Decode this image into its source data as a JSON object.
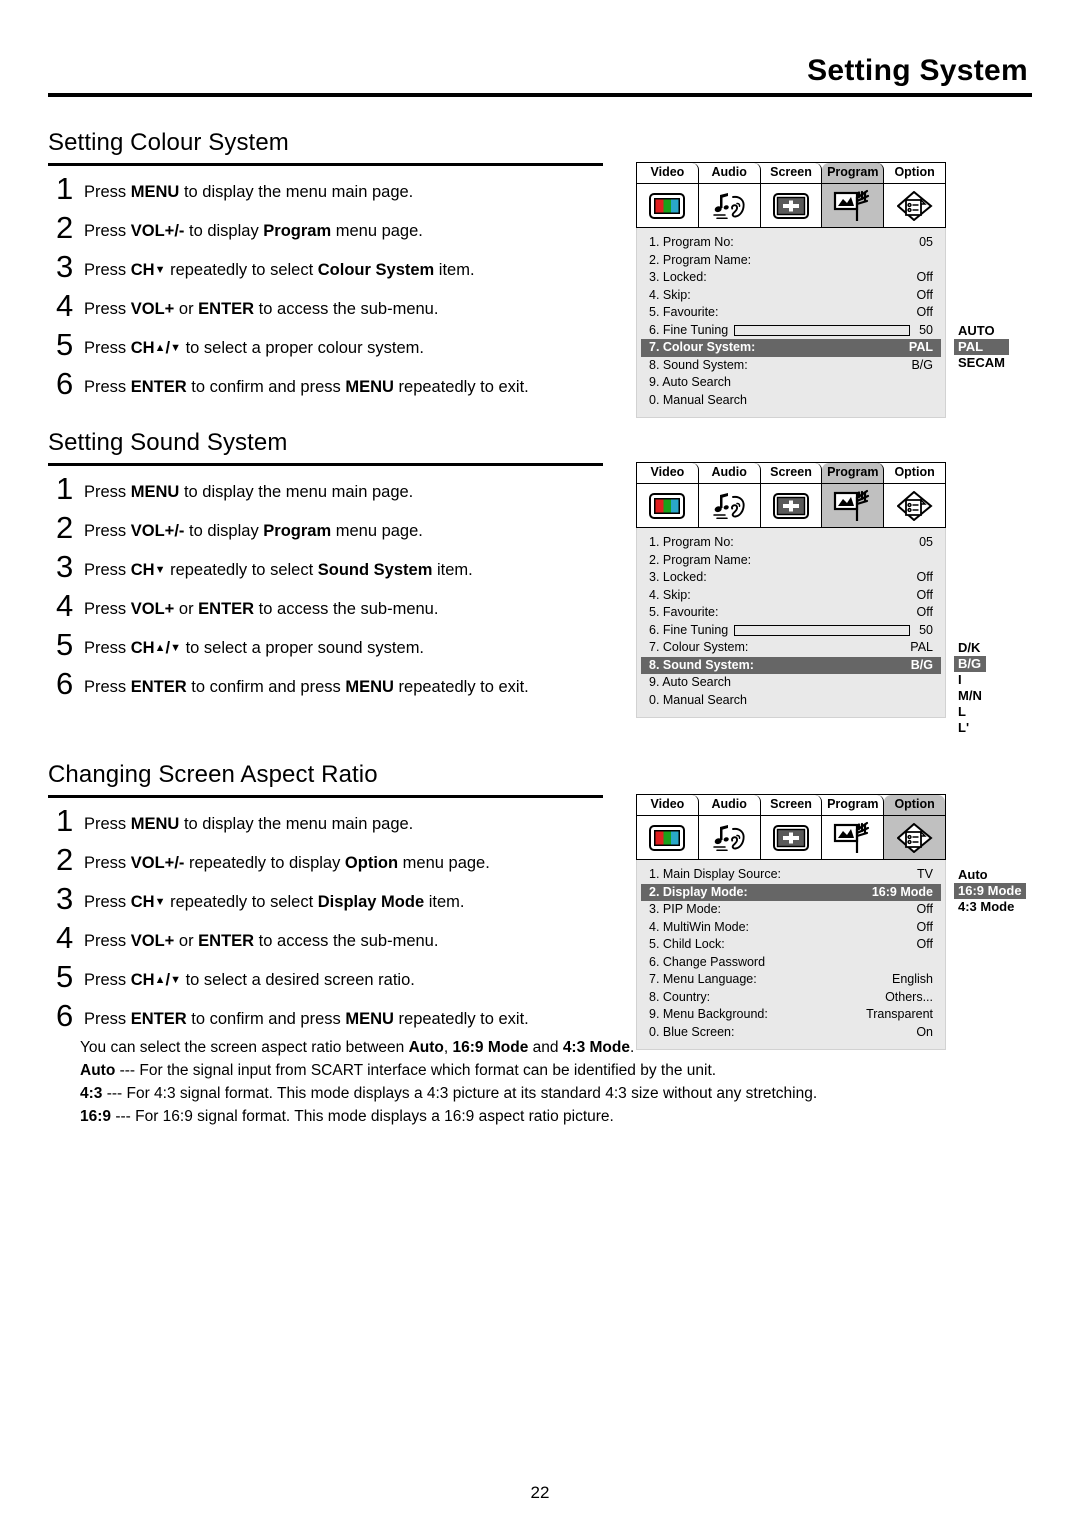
{
  "header": {
    "title": "Setting System"
  },
  "page_number": "22",
  "sections": [
    {
      "title": "Setting Colour System",
      "steps": [
        {
          "num": "1",
          "parts": [
            {
              "t": "Press ",
              "b": false
            },
            {
              "t": "MENU",
              "b": true
            },
            {
              "t": " to display the menu main page.",
              "b": false
            }
          ]
        },
        {
          "num": "2",
          "parts": [
            {
              "t": "Press ",
              "b": false
            },
            {
              "t": "VOL+/-",
              "b": true
            },
            {
              "t": " to display ",
              "b": false
            },
            {
              "t": "Program",
              "b": true
            },
            {
              "t": " menu page.",
              "b": false
            }
          ]
        },
        {
          "num": "3",
          "parts": [
            {
              "t": "Press ",
              "b": false
            },
            {
              "t": "CH",
              "b": true
            },
            {
              "t": "▼",
              "b": true,
              "arrow": true
            },
            {
              "t": " repeatedly to select ",
              "b": false
            },
            {
              "t": "Colour System",
              "b": true
            },
            {
              "t": " item.",
              "b": false
            }
          ]
        },
        {
          "num": "4",
          "parts": [
            {
              "t": "Press ",
              "b": false
            },
            {
              "t": "VOL+",
              "b": true
            },
            {
              "t": " or ",
              "b": false
            },
            {
              "t": "ENTER",
              "b": true
            },
            {
              "t": " to access the sub-menu.",
              "b": false
            }
          ]
        },
        {
          "num": "5",
          "parts": [
            {
              "t": "Press ",
              "b": false
            },
            {
              "t": "CH",
              "b": true
            },
            {
              "t": "▲",
              "b": true,
              "arrow": true
            },
            {
              "t": "/",
              "b": true
            },
            {
              "t": "▼",
              "b": true,
              "arrow": true
            },
            {
              "t": " to select a proper colour system.",
              "b": false
            }
          ]
        },
        {
          "num": "6",
          "parts": [
            {
              "t": "Press ",
              "b": false
            },
            {
              "t": "ENTER",
              "b": true
            },
            {
              "t": " to confirm and press ",
              "b": false
            },
            {
              "t": "MENU",
              "b": true
            },
            {
              "t": " repeatedly to exit.",
              "b": false
            }
          ]
        }
      ]
    },
    {
      "title": "Setting Sound System",
      "steps": [
        {
          "num": "1",
          "parts": [
            {
              "t": "Press ",
              "b": false
            },
            {
              "t": "MENU",
              "b": true
            },
            {
              "t": " to display the menu main page.",
              "b": false
            }
          ]
        },
        {
          "num": "2",
          "parts": [
            {
              "t": "Press ",
              "b": false
            },
            {
              "t": "VOL+/-",
              "b": true
            },
            {
              "t": " to display ",
              "b": false
            },
            {
              "t": "Program",
              "b": true
            },
            {
              "t": " menu page.",
              "b": false
            }
          ]
        },
        {
          "num": "3",
          "parts": [
            {
              "t": "Press ",
              "b": false
            },
            {
              "t": "CH",
              "b": true
            },
            {
              "t": "▼",
              "b": true,
              "arrow": true
            },
            {
              "t": " repeatedly to select ",
              "b": false
            },
            {
              "t": "Sound System",
              "b": true
            },
            {
              "t": " item.",
              "b": false
            }
          ]
        },
        {
          "num": "4",
          "parts": [
            {
              "t": "Press ",
              "b": false
            },
            {
              "t": "VOL+",
              "b": true
            },
            {
              "t": " or ",
              "b": false
            },
            {
              "t": "ENTER",
              "b": true
            },
            {
              "t": " to access the sub-menu.",
              "b": false
            }
          ]
        },
        {
          "num": "5",
          "parts": [
            {
              "t": "Press ",
              "b": false
            },
            {
              "t": "CH",
              "b": true
            },
            {
              "t": "▲",
              "b": true,
              "arrow": true
            },
            {
              "t": "/",
              "b": true
            },
            {
              "t": "▼",
              "b": true,
              "arrow": true
            },
            {
              "t": " to select a proper sound system.",
              "b": false
            }
          ]
        },
        {
          "num": "6",
          "parts": [
            {
              "t": "Press ",
              "b": false
            },
            {
              "t": "ENTER",
              "b": true
            },
            {
              "t": " to confirm and press ",
              "b": false
            },
            {
              "t": "MENU",
              "b": true
            },
            {
              "t": " repeatedly to exit.",
              "b": false
            }
          ]
        }
      ]
    },
    {
      "title": "Changing Screen Aspect Ratio",
      "steps": [
        {
          "num": "1",
          "parts": [
            {
              "t": "Press ",
              "b": false
            },
            {
              "t": "MENU",
              "b": true
            },
            {
              "t": " to display the menu main page.",
              "b": false
            }
          ]
        },
        {
          "num": "2",
          "parts": [
            {
              "t": "Press ",
              "b": false
            },
            {
              "t": "VOL+/-",
              "b": true
            },
            {
              "t": " repeatedly to display ",
              "b": false
            },
            {
              "t": "Option",
              "b": true
            },
            {
              "t": " menu page.",
              "b": false
            }
          ]
        },
        {
          "num": "3",
          "parts": [
            {
              "t": "Press ",
              "b": false
            },
            {
              "t": "CH",
              "b": true
            },
            {
              "t": "▼",
              "b": true,
              "arrow": true
            },
            {
              "t": " repeatedly to select ",
              "b": false
            },
            {
              "t": "Display Mode",
              "b": true
            },
            {
              "t": " item.",
              "b": false
            }
          ]
        },
        {
          "num": "4",
          "parts": [
            {
              "t": "Press ",
              "b": false
            },
            {
              "t": "VOL+",
              "b": true
            },
            {
              "t": " or ",
              "b": false
            },
            {
              "t": "ENTER",
              "b": true
            },
            {
              "t": " to access the sub-menu.",
              "b": false
            }
          ]
        },
        {
          "num": "5",
          "parts": [
            {
              "t": "Press ",
              "b": false
            },
            {
              "t": "CH",
              "b": true
            },
            {
              "t": "▲",
              "b": true,
              "arrow": true
            },
            {
              "t": "/",
              "b": true
            },
            {
              "t": "▼",
              "b": true,
              "arrow": true
            },
            {
              "t": " to select a desired screen ratio.",
              "b": false
            }
          ]
        },
        {
          "num": "6",
          "parts": [
            {
              "t": "Press ",
              "b": false
            },
            {
              "t": "ENTER",
              "b": true
            },
            {
              "t": " to confirm and press ",
              "b": false
            },
            {
              "t": "MENU",
              "b": true
            },
            {
              "t": " repeatedly to exit.",
              "b": false
            }
          ]
        }
      ]
    }
  ],
  "osd_tabs": [
    "Video",
    "Audio",
    "Screen",
    "Program",
    "Option"
  ],
  "osd_icon_names": [
    "video-colorbars-icon",
    "audio-note-ear-icon",
    "screen-crosshair-icon",
    "program-antenna-icon",
    "option-checklist-icon"
  ],
  "osd_panels": [
    {
      "active_tab": "Program",
      "active_index": 3,
      "rows": [
        {
          "label": "1. Program No:",
          "value": "05",
          "selected": false,
          "slider": false
        },
        {
          "label": "2. Program Name:",
          "value": "",
          "selected": false,
          "slider": false
        },
        {
          "label": "3. Locked:",
          "value": "Off",
          "selected": false,
          "slider": false
        },
        {
          "label": "4. Skip:",
          "value": "Off",
          "selected": false,
          "slider": false
        },
        {
          "label": "5. Favourite:",
          "value": "Off",
          "selected": false,
          "slider": false
        },
        {
          "label": "6. Fine Tuning",
          "value": "50",
          "selected": false,
          "slider": true,
          "slider_fill": 0
        },
        {
          "label": "7. Colour System:",
          "value": "PAL",
          "selected": true,
          "slider": false
        },
        {
          "label": "8. Sound System:",
          "value": "B/G",
          "selected": false,
          "slider": false
        },
        {
          "label": "9. Auto Search",
          "value": "",
          "selected": false,
          "slider": false
        },
        {
          "label": "0. Manual Search",
          "value": "",
          "selected": false,
          "slider": false
        }
      ],
      "submenu": {
        "options": [
          "AUTO",
          "PAL",
          "SECAM"
        ],
        "selected": "PAL"
      }
    },
    {
      "active_tab": "Program",
      "active_index": 3,
      "rows": [
        {
          "label": "1. Program No:",
          "value": "05",
          "selected": false,
          "slider": false
        },
        {
          "label": "2. Program Name:",
          "value": "",
          "selected": false,
          "slider": false
        },
        {
          "label": "3. Locked:",
          "value": "Off",
          "selected": false,
          "slider": false
        },
        {
          "label": "4. Skip:",
          "value": "Off",
          "selected": false,
          "slider": false
        },
        {
          "label": "5. Favourite:",
          "value": "Off",
          "selected": false,
          "slider": false
        },
        {
          "label": "6. Fine Tuning",
          "value": "50",
          "selected": false,
          "slider": true,
          "slider_fill": 0
        },
        {
          "label": "7. Colour System:",
          "value": "PAL",
          "selected": false,
          "slider": false
        },
        {
          "label": "8. Sound System:",
          "value": "B/G",
          "selected": true,
          "slider": false
        },
        {
          "label": "9. Auto Search",
          "value": "",
          "selected": false,
          "slider": false
        },
        {
          "label": "0. Manual Search",
          "value": "",
          "selected": false,
          "slider": false
        }
      ],
      "submenu": {
        "options": [
          "D/K",
          "B/G",
          "I",
          "M/N",
          "L",
          "L'"
        ],
        "selected": "B/G"
      }
    },
    {
      "active_tab": "Option",
      "active_index": 4,
      "rows": [
        {
          "label": "1. Main Display Source:",
          "value": "TV",
          "selected": false,
          "slider": false
        },
        {
          "label": "2. Display Mode:",
          "value": "16:9 Mode",
          "selected": true,
          "slider": false
        },
        {
          "label": "3. PIP Mode:",
          "value": "Off",
          "selected": false,
          "slider": false
        },
        {
          "label": "4. MultiWin Mode:",
          "value": "Off",
          "selected": false,
          "slider": false
        },
        {
          "label": "5. Child Lock:",
          "value": "Off",
          "selected": false,
          "slider": false
        },
        {
          "label": "6. Change Password",
          "value": "",
          "selected": false,
          "slider": false
        },
        {
          "label": "7. Menu Language:",
          "value": "English",
          "selected": false,
          "slider": false
        },
        {
          "label": "8. Country:",
          "value": "Others...",
          "selected": false,
          "slider": false
        },
        {
          "label": "9. Menu Background:",
          "value": "Transparent",
          "selected": false,
          "slider": false
        },
        {
          "label": "0. Blue Screen:",
          "value": "On",
          "selected": false,
          "slider": false
        }
      ],
      "submenu": {
        "options": [
          "Auto",
          "16:9 Mode",
          "4:3 Mode"
        ],
        "selected": "16:9 Mode"
      }
    }
  ],
  "notes": [
    [
      {
        "t": "You can select the screen aspect ratio between ",
        "b": false
      },
      {
        "t": "Auto",
        "b": true
      },
      {
        "t": ", ",
        "b": false
      },
      {
        "t": "16:9 Mode",
        "b": true
      },
      {
        "t": " and ",
        "b": false
      },
      {
        "t": "4:3 Mode",
        "b": true
      },
      {
        "t": ".",
        "b": false
      }
    ],
    [
      {
        "t": "Auto",
        "b": true
      },
      {
        "t": " --- For the signal input from SCART interface which format can be identified by the unit.",
        "b": false
      }
    ],
    [
      {
        "t": "4:3",
        "b": true
      },
      {
        "t": " --- For 4:3 signal format. This mode displays a 4:3 picture at its standard 4:3 size without any stretching.",
        "b": false
      }
    ],
    [
      {
        "t": "16:9",
        "b": true
      },
      {
        "t": " --- For 16:9 signal format. This mode displays a 16:9 aspect ratio picture.",
        "b": false
      }
    ]
  ],
  "colors": {
    "menu_body_bg": "#e9e9e9",
    "selected_row_bg": "#666666",
    "active_tab_bg": "#c0c0c0",
    "video_icon_red": "#e02020",
    "video_icon_green": "#1aa11a",
    "video_icon_cyan": "#2aa8c8"
  }
}
